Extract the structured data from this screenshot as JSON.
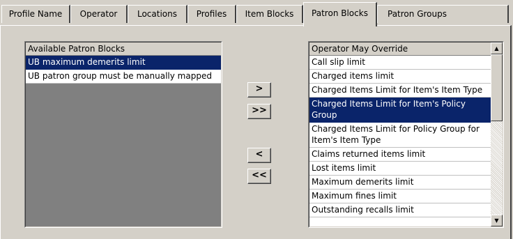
{
  "tabs": [
    {
      "label": "Profile Name"
    },
    {
      "label": "Operator"
    },
    {
      "label": "Locations"
    },
    {
      "label": "Profiles"
    },
    {
      "label": "Item Blocks"
    },
    {
      "label": "Patron Blocks"
    },
    {
      "label": "Patron Groups"
    }
  ],
  "available": {
    "header": "Available Patron Blocks",
    "items": [
      {
        "label": "UB maximum demerits limit"
      },
      {
        "label": "UB patron group must be manually mapped"
      }
    ]
  },
  "buttons": {
    "add": ">",
    "add_all": ">>",
    "remove": "<",
    "remove_all": "<<"
  },
  "override": {
    "header": "Operator May Override",
    "items": [
      {
        "label": "Call slip limit"
      },
      {
        "label": "Charged items limit"
      },
      {
        "label": "Charged Items Limit for Item's Item Type"
      },
      {
        "label": "Charged Items Limit for Item's Policy Group"
      },
      {
        "label": "Charged Items Limit for Policy Group for Item's Item Type"
      },
      {
        "label": "Claims returned items limit"
      },
      {
        "label": "Lost items limit"
      },
      {
        "label": "Maximum demerits limit"
      },
      {
        "label": "Maximum fines limit"
      },
      {
        "label": "Outstanding recalls limit"
      }
    ]
  },
  "icons": {
    "scroll_up": "up-arrow",
    "scroll_down": "down-arrow"
  }
}
